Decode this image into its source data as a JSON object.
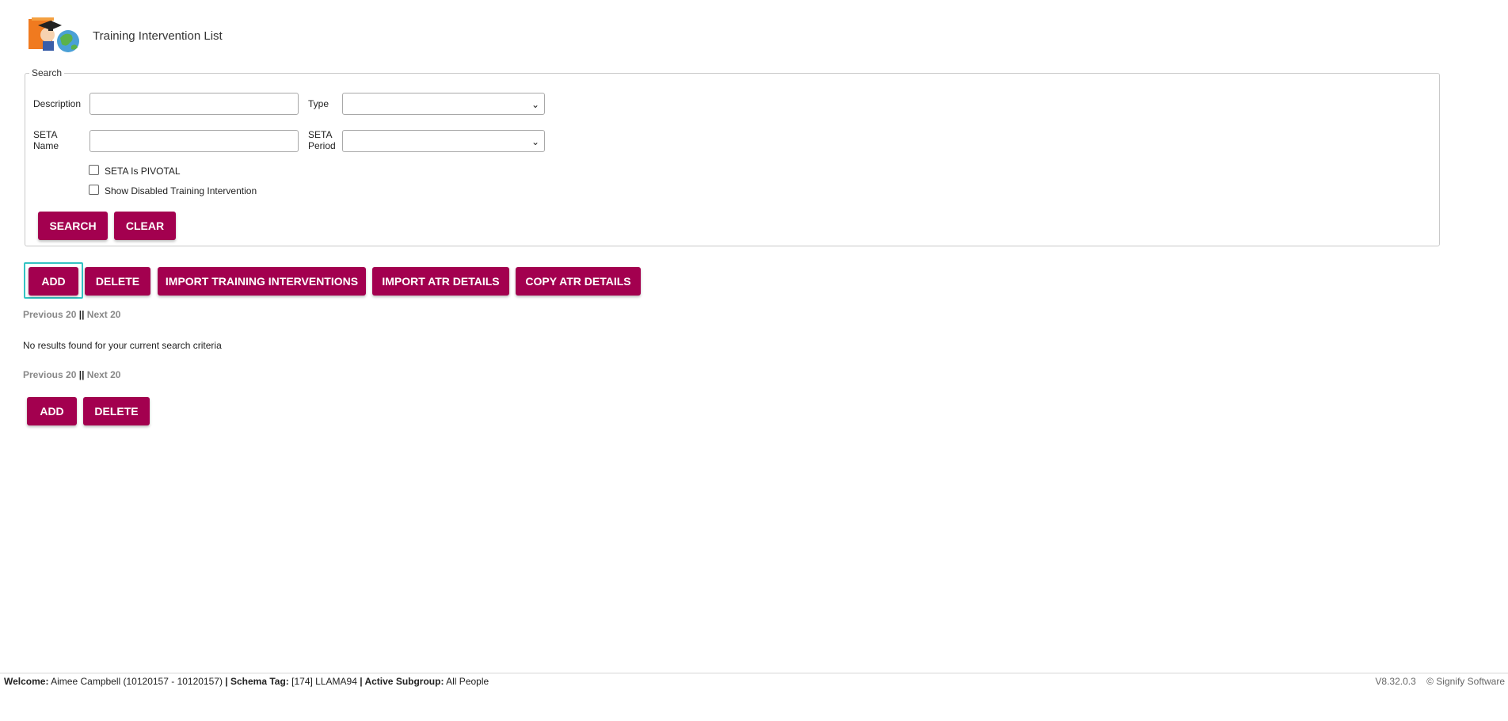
{
  "header": {
    "title": "Training Intervention List",
    "logo_icon": "training-graduate-globe-icon"
  },
  "search": {
    "legend": "Search",
    "description_label": "Description",
    "description_value": "",
    "type_label": "Type",
    "type_value": "",
    "seta_name_label_1": "SETA",
    "seta_name_label_2": "Name",
    "seta_name_value": "",
    "seta_period_label_1": "SETA",
    "seta_period_label_2": "Period",
    "seta_period_value": "",
    "pivotal_label": "SETA Is PIVOTAL",
    "pivotal_checked": false,
    "show_disabled_label": "Show Disabled Training Intervention",
    "show_disabled_checked": false,
    "search_button": "Search",
    "clear_button": "Clear"
  },
  "toolbar_top": {
    "add": "Add",
    "delete": "Delete",
    "import_training": "Import Training Interventions",
    "import_atr": "Import ATR Details",
    "copy_atr": "Copy ATR Details"
  },
  "pager": {
    "prev": "Previous 20",
    "sep": "||",
    "next": "Next 20"
  },
  "results": {
    "message": "No results found for your current search criteria"
  },
  "toolbar_bottom": {
    "add": "Add",
    "delete": "Delete"
  },
  "footer": {
    "welcome_label": "Welcome:",
    "welcome_value": "Aimee Campbell (10120157 - 10120157)",
    "schema_label": "| Schema Tag:",
    "schema_value": "[174] LLAMA94",
    "subgroup_label": "| Active Subgroup:",
    "subgroup_value": "All People",
    "version": "V8.32.0.3",
    "copyright": "© Signify Software"
  },
  "colors": {
    "button": "#a3004f",
    "focus": "#34c3c3"
  }
}
